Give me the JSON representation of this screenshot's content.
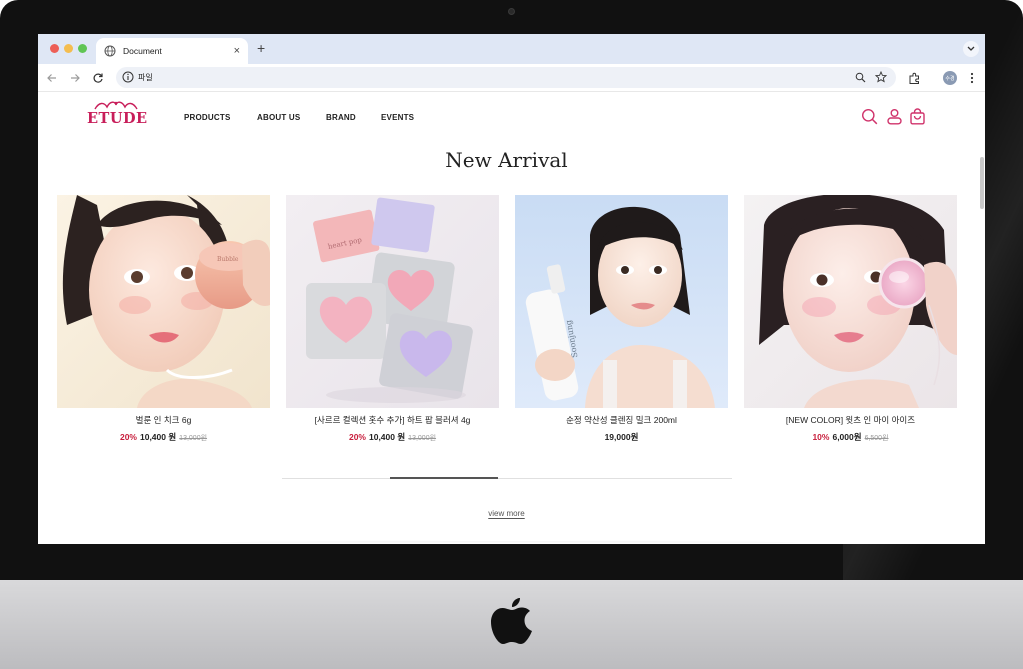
{
  "browser": {
    "tab_title": "Document",
    "new_tab_label": "+",
    "tab_close_label": "×",
    "address": "파일",
    "profile_initials": "수경"
  },
  "site": {
    "logo": "ETUDE",
    "nav": [
      "PRODUCTS",
      "ABOUT US",
      "BRAND",
      "EVENTS"
    ],
    "icons": [
      "search-icon",
      "user-icon",
      "bag-icon"
    ],
    "brand_color": "#c81e5a"
  },
  "section": {
    "title": "New Arrival",
    "view_more": "view more",
    "carousel_progress": 0.24
  },
  "products": [
    {
      "name": "벌룬 인 치크 6g",
      "discount": "20%",
      "price": "10,400 원",
      "original": "13,000원"
    },
    {
      "name": "[사르르 컬렉션 홋수 추가] 하트 팝 블러셔 4g",
      "discount": "20%",
      "price": "10,400 원",
      "original": "13,000원"
    },
    {
      "name": "순정 약산성 클렌징 밀크 200ml",
      "discount": "",
      "price": "19,000원",
      "original": ""
    },
    {
      "name": "[NEW COLOR] 윗츠 인 마이 아이즈",
      "discount": "10%",
      "price": "6,000원",
      "original": "6,500원"
    }
  ]
}
